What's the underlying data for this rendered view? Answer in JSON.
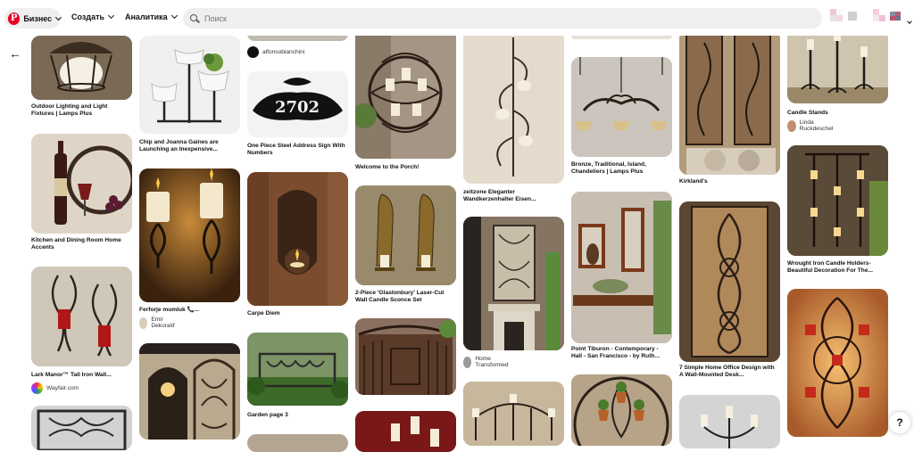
{
  "header": {
    "business_label": "Бизнес",
    "create_label": "Создать",
    "analytics_label": "Аналитика",
    "search_placeholder": "Поиск"
  },
  "pins": [
    {
      "id": "p1",
      "title": "Outdoor Lighting and Light Fixtures | Lamps Plus",
      "color": "#6b5a45",
      "icon": "hanging-lamp"
    },
    {
      "id": "p2",
      "title": "Kitchen and Dining Room Home Accents",
      "color": "#ddd3c4",
      "icon": "wine-wall-art"
    },
    {
      "id": "p3",
      "title": "Lark Manor™ Tall Iron Wall...",
      "sub": "Wayfair.com",
      "color": "#c9c1b2",
      "icon": "red-candle-sconce"
    },
    {
      "id": "p4",
      "title": "",
      "color": "#c8c8c8",
      "icon": "iron-panel"
    },
    {
      "id": "p5",
      "title": "Chip and Joanna Gaines are Launching an Inexpensive...",
      "color": "#f1f1f1",
      "icon": "plant-stand"
    },
    {
      "id": "p6",
      "title": "Ferforje mumluk 📞...",
      "sub": "Emir Dekoratif",
      "color": "#5a3a1c",
      "icon": "candle-holders"
    },
    {
      "id": "p7",
      "title": "",
      "color": "#b8a98e",
      "icon": "wall-mirror"
    },
    {
      "id": "p8",
      "sub": "alfonsobianchini",
      "color": "#c0b9ae",
      "icon": "cropped"
    },
    {
      "id": "p9",
      "title": "One Piece Steel Address Sign With Numbers",
      "color": "#f4f4f4",
      "icon": "address-sign"
    },
    {
      "id": "p10",
      "title": "Carpe Diem",
      "color": "#7a4a2a",
      "icon": "wood-candle"
    },
    {
      "id": "p11",
      "title": "Garden page 3",
      "color": "#6f8a5a",
      "icon": "garden-fence"
    },
    {
      "id": "p12",
      "title": "Welcome to the Porch!",
      "color": "#9a8b7d",
      "icon": "porch-sconce"
    },
    {
      "id": "p13",
      "title": "2-Piece 'Glastonbury' Laser-Cut Wall Candle Sconce Set",
      "color": "#8b7b5e",
      "icon": "sconce-set"
    },
    {
      "id": "p14",
      "title": "",
      "color": "#6b4a35",
      "icon": "iron-gate"
    },
    {
      "id": "p15",
      "title": "",
      "color": "#7a1a1a",
      "icon": "red-room"
    },
    {
      "id": "p16",
      "title": "zeitzone Eleganter Wandkerzenhalter Eisen...",
      "color": "#e3d9c9",
      "icon": "wall-candle"
    },
    {
      "id": "p17",
      "title": "",
      "sub": "Home Transformed",
      "color": "#7a6a58",
      "icon": "fireplace"
    },
    {
      "id": "p18",
      "title": "",
      "color": "#c9b99e",
      "icon": "candelabra"
    },
    {
      "id": "p19",
      "title": "Bronze, Traditional, Island, Chandeliers | Lamps Plus",
      "color": "#c7c2bb",
      "icon": "chandelier"
    },
    {
      "id": "p20",
      "title": "Point Tiburon - Contemporary - Hall - San Francisco - by Ruth...",
      "color": "#8a5a3a",
      "icon": "wall-shelves"
    },
    {
      "id": "p21",
      "title": "",
      "color": "#b8a48a",
      "icon": "circle-planter"
    },
    {
      "id": "p22",
      "title": "Kirkland's",
      "color": "#a38c6c",
      "icon": "wall-panels"
    },
    {
      "id": "p23",
      "title": "7 Simple Home Office Design with A Wall-Mounted Desk...",
      "color": "#8a6a4a",
      "icon": "scroll-art"
    },
    {
      "id": "p24",
      "title": "",
      "color": "#d8d8d8",
      "icon": "candle-trio"
    },
    {
      "id": "p25",
      "title": "Candle Stands",
      "sub": "Linda Ruckdeschel",
      "color": "#c4b8a2",
      "icon": "floor-candles"
    },
    {
      "id": "p26",
      "title": "Wrought Iron Candle Holders- Beautiful Decoration For The...",
      "color": "#4a3a2a",
      "icon": "candle-grid"
    },
    {
      "id": "p27",
      "title": "",
      "color": "#d09060",
      "icon": "glow-sconce"
    }
  ]
}
